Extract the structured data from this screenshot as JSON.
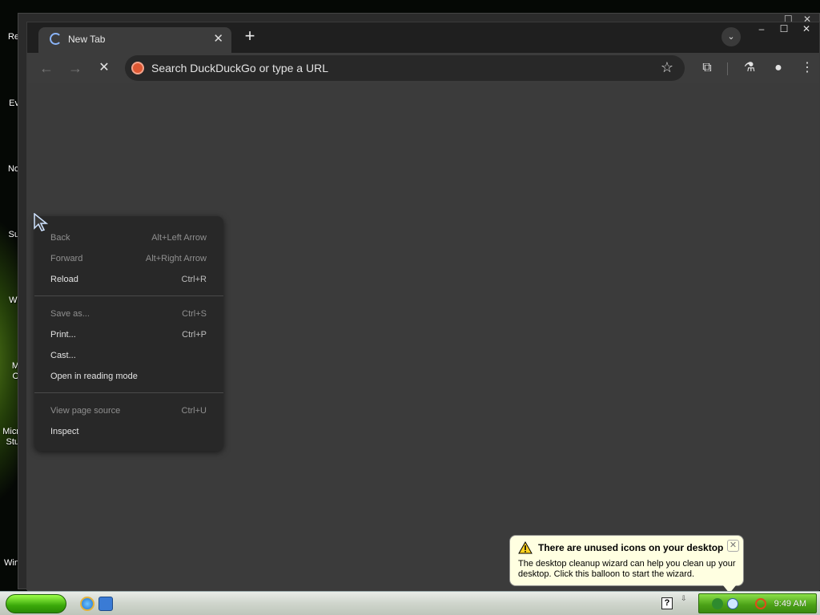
{
  "desktop": {
    "icons": [
      {
        "label": "Re",
        "name": "desktop-icon-recycle-bin"
      },
      {
        "label": "Ev",
        "name": "desktop-icon-ev"
      },
      {
        "label": "No",
        "name": "desktop-icon-no"
      },
      {
        "label": "Su",
        "name": "desktop-icon-su"
      },
      {
        "label": "Wi",
        "name": "desktop-icon-wi"
      },
      {
        "label": "M",
        "name": "desktop-icon-m"
      },
      {
        "label": "O",
        "name": "desktop-icon-o"
      },
      {
        "label": "Micr",
        "name": "desktop-icon-micr"
      },
      {
        "label": "Stu",
        "name": "desktop-icon-stu"
      },
      {
        "label": "Win",
        "name": "desktop-icon-win"
      }
    ]
  },
  "browser": {
    "tab": {
      "title": "New Tab",
      "close": "✕"
    },
    "new_tab": "+",
    "tab_search": "⌄",
    "window_controls": {
      "minimize": "–",
      "maximize": "☐",
      "close": "✕"
    },
    "toolbar": {
      "back": "←",
      "forward": "→",
      "stop": "✕",
      "omnibox_placeholder": "Search DuckDuckGo or type a URL",
      "bookmark": "☆",
      "extensions": "⧉",
      "labs": "⚗",
      "profile": "●",
      "menu": "⋮"
    }
  },
  "context_menu": {
    "items": [
      {
        "label": "Back",
        "shortcut": "Alt+Left Arrow",
        "enabled": false
      },
      {
        "label": "Forward",
        "shortcut": "Alt+Right Arrow",
        "enabled": false
      },
      {
        "label": "Reload",
        "shortcut": "Ctrl+R",
        "enabled": true
      },
      {
        "label": "Save as...",
        "shortcut": "Ctrl+S",
        "enabled": false
      },
      {
        "label": "Print...",
        "shortcut": "Ctrl+P",
        "enabled": true
      },
      {
        "label": "Cast...",
        "shortcut": "",
        "enabled": true
      },
      {
        "label": "Open in reading mode",
        "shortcut": "",
        "enabled": true
      },
      {
        "label": "View page source",
        "shortcut": "Ctrl+U",
        "enabled": false
      },
      {
        "label": "Inspect",
        "shortcut": "",
        "enabled": true
      }
    ]
  },
  "balloon": {
    "title": "There are unused icons on your desktop",
    "body": "The desktop cleanup wizard can help you clean up your desktop. Click this balloon to start the wizard.",
    "close": "✕"
  },
  "taskbar": {
    "help": "?",
    "tray_expand": "⇩",
    "clock": "9:49 AM"
  },
  "colors": {
    "browser_frame": "#1f1f1f",
    "toolbar": "#3c3c3c",
    "content": "#3b3b3b",
    "menu_bg": "#282828",
    "balloon_bg": "#ffffe1",
    "tray_green": "#4aa016"
  }
}
